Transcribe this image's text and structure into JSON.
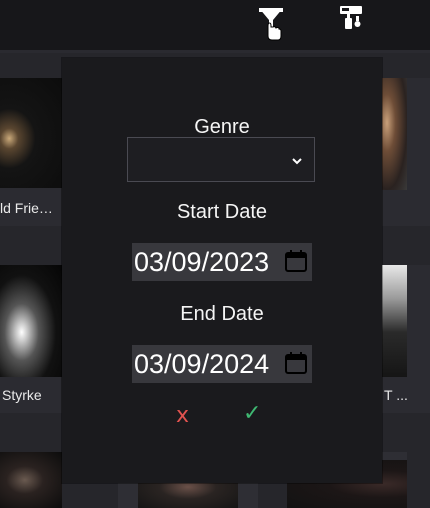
{
  "toolbar": {
    "filter_icon": "filter-icon",
    "paint_icon": "paint-roller-icon"
  },
  "cards": [
    {
      "label": "ld Frie…"
    },
    {
      "label": "Styrke"
    },
    {
      "label": "T ..."
    }
  ],
  "filter_panel": {
    "genre_label": "Genre",
    "genre_value": "",
    "start_date_label": "Start Date",
    "start_date_value": "03/09/2023",
    "end_date_label": "End Date",
    "end_date_value": "03/09/2024",
    "cancel_glyph": "x",
    "confirm_glyph": "✓",
    "colors": {
      "cancel": "#e0524f",
      "confirm": "#3fb872",
      "panel_bg": "#1a1a1d",
      "input_bg": "#38383d"
    }
  }
}
